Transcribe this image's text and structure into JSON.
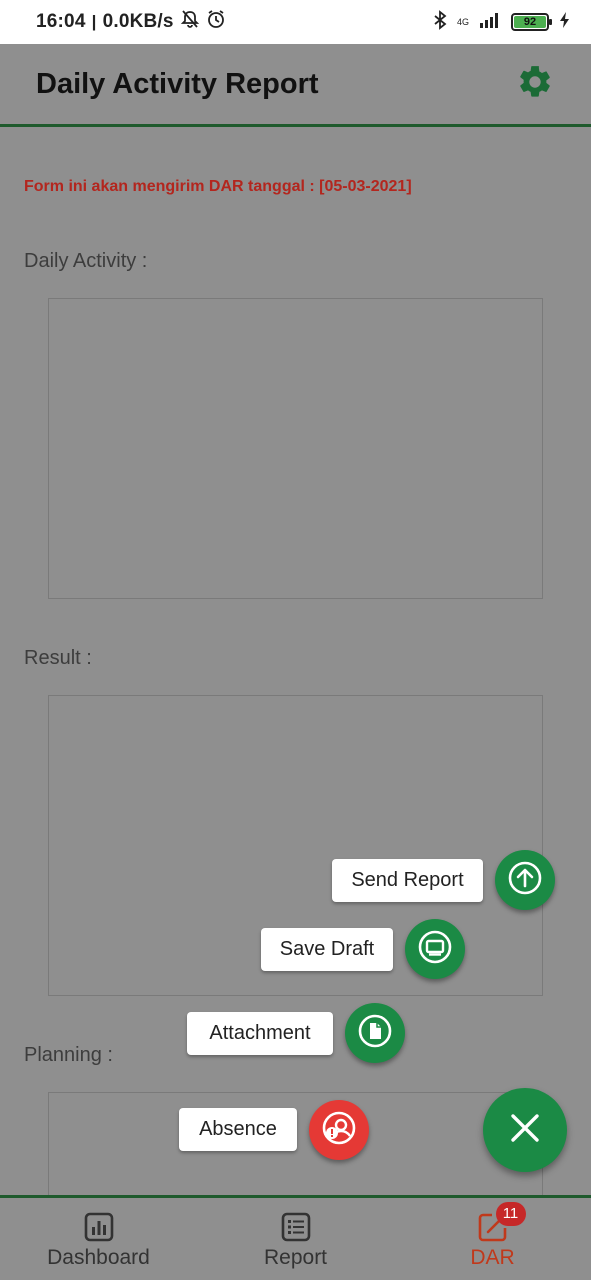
{
  "status_bar": {
    "time": "16:04",
    "speed": "0.0KB/s",
    "network": "4G",
    "battery": "92",
    "icons": [
      "mute-icon",
      "alarm-icon",
      "bluetooth-icon",
      "signal-icon",
      "battery-icon",
      "charging-icon"
    ]
  },
  "header": {
    "title": "Daily Activity Report",
    "settings_icon": "gear-icon"
  },
  "form": {
    "notice": "Form ini akan mengirim DAR tanggal : [05-03-2021]",
    "daily_activity_label": "Daily Activity :",
    "daily_activity_value": "",
    "result_label": "Result :",
    "result_value": "",
    "planning_label": "Planning :",
    "planning_value": ""
  },
  "speed_dial": {
    "send_report": "Send Report",
    "save_draft": "Save Draft",
    "attachment": "Attachment",
    "absence": "Absence",
    "close_icon": "close-icon"
  },
  "nav": {
    "dashboard": "Dashboard",
    "report": "Report",
    "dar": "DAR",
    "dar_badge": "11"
  },
  "colors": {
    "accent": "#1b8a45",
    "header_border": "#1e5a2c",
    "notice": "#b3261e",
    "absence": "#e53935",
    "active_nav": "#c0391b"
  }
}
